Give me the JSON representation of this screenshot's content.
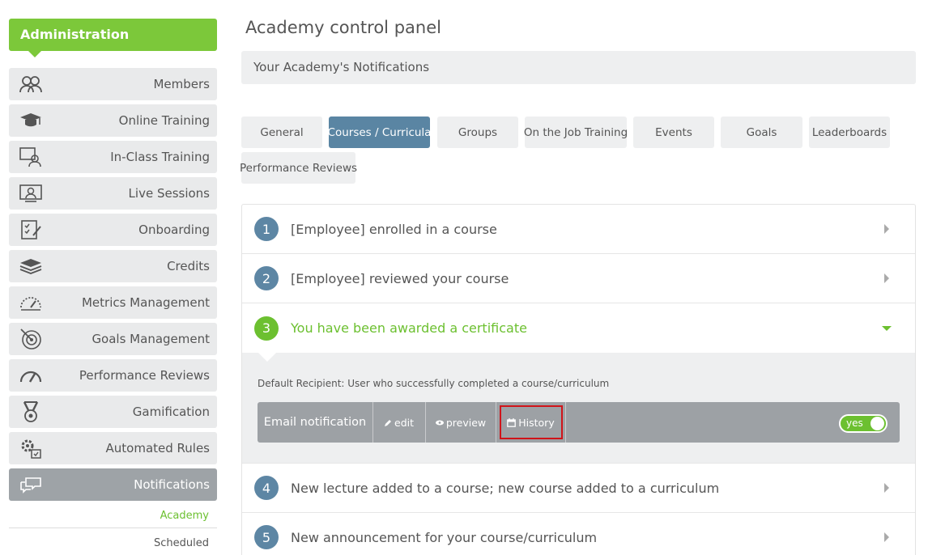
{
  "sidebar": {
    "header": "Administration",
    "items": [
      {
        "label": "Members",
        "icon": "members-icon"
      },
      {
        "label": "Online Training",
        "icon": "graduation-cap-icon"
      },
      {
        "label": "In-Class Training",
        "icon": "classroom-icon"
      },
      {
        "label": "Live Sessions",
        "icon": "live-session-icon"
      },
      {
        "label": "Onboarding",
        "icon": "checklist-icon"
      },
      {
        "label": "Credits",
        "icon": "layers-icon"
      },
      {
        "label": "Metrics Management",
        "icon": "gauge-icon"
      },
      {
        "label": "Goals Management",
        "icon": "target-icon"
      },
      {
        "label": "Performance Reviews",
        "icon": "speedometer-icon"
      },
      {
        "label": "Gamification",
        "icon": "medal-icon"
      },
      {
        "label": "Automated Rules",
        "icon": "gears-icon"
      },
      {
        "label": "Notifications",
        "icon": "chat-bubbles-icon"
      }
    ],
    "subitems": [
      {
        "label": "Academy",
        "color": "#6cc030"
      },
      {
        "label": "Scheduled",
        "color": "#555555"
      }
    ]
  },
  "main": {
    "title": "Academy control panel",
    "section": "Your Academy's Notifications",
    "tabs": [
      {
        "label": "General"
      },
      {
        "label": "Courses / Curricula",
        "active": true
      },
      {
        "label": "Groups"
      },
      {
        "label": "On the Job Training"
      },
      {
        "label": "Events"
      },
      {
        "label": "Goals"
      },
      {
        "label": "Leaderboards"
      },
      {
        "label": "Performance Reviews"
      }
    ],
    "notifications": [
      {
        "num": "1",
        "title": "[Employee] enrolled in a course"
      },
      {
        "num": "2",
        "title": "[Employee] reviewed your course"
      },
      {
        "num": "3",
        "title": "You have been awarded a certificate",
        "expanded": true
      },
      {
        "num": "4",
        "title": "New lecture added to a course; new course added to a curriculum"
      },
      {
        "num": "5",
        "title": "New announcement for your course/curriculum"
      }
    ],
    "expanded": {
      "recipient": "Default Recipient: User who successfully completed a course/curriculum",
      "email_label": "Email notification",
      "edit": "edit",
      "preview": "preview",
      "history": "History",
      "toggle": "yes"
    }
  },
  "colors": {
    "accent_green": "#7cc83a",
    "tab_active": "#5a85a3",
    "number_badge": "#5d86a4",
    "highlight_red": "#d0141a"
  }
}
